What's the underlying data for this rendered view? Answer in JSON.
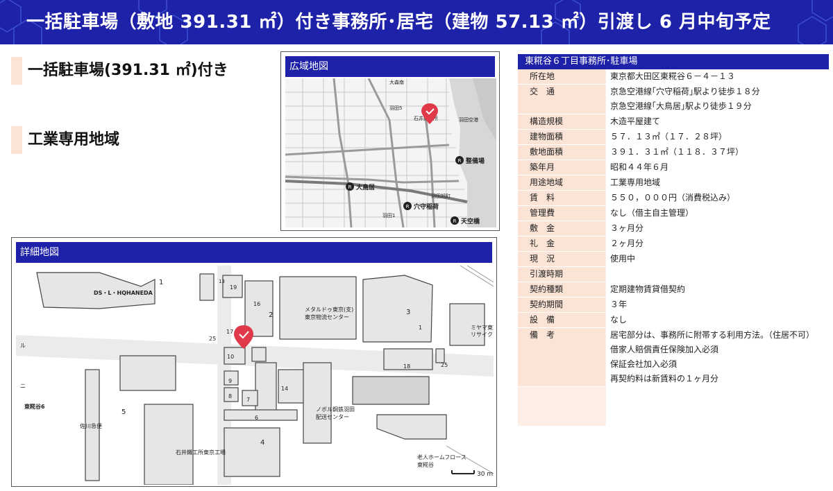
{
  "banner": {
    "title": "一括駐車場（敷地 391.31 ㎡）付き事務所･居宅（建物 57.13 ㎡）引渡し 6 月中旬予定"
  },
  "highlights": [
    {
      "text": "一括駐車場(391.31 ㎡)付き"
    },
    {
      "text": "工業専用地域"
    }
  ],
  "wide_map": {
    "title": "広域地図",
    "labels": {
      "station_otorii": "大鳥居",
      "station_anamori": "穴守稲荷",
      "station_seibijo": "整備場",
      "station_tenku": "天空橋",
      "haneda_airport": "羽田空港",
      "ishii": "石井鐵工所",
      "omori": "大森南",
      "gaso": "羽田旭町",
      "haneda_1": "羽田1",
      "haneda_5": "羽田5"
    }
  },
  "detail_map": {
    "title": "詳細地図",
    "labels": {
      "ds_l": "DS・L・HQHANEDA",
      "metal": "メタルドゥ東京(支)",
      "metal2": "東京物流センター",
      "miyama": "ミヤマ東京",
      "miyama2": "リサイク",
      "higashi": "東糀谷6",
      "sagawa": "佐川急便",
      "nobori": "ノボル鋼鉄羽田",
      "nobori2": "配送センター",
      "ishii_kojo": "石井鐵工所東京工場",
      "roujin": "老人ホームフロース",
      "roujin2": "東糀谷",
      "scale": "30 m",
      "blk_1": "1",
      "blk_2": "2",
      "blk_3": "3",
      "blk_4": "4",
      "blk_5": "5",
      "blk_6": "6",
      "blk_7": "7",
      "blk_8": "8",
      "blk_9": "9",
      "blk_10": "10",
      "blk_13": "13",
      "blk_14": "14",
      "blk_16": "16",
      "blk_17": "17",
      "blk_18": "18",
      "blk_19": "19",
      "blk_25a": "25",
      "blk_25b": "25",
      "blk_1b": "1",
      "edge_ru": "ル",
      "edge_ni": "ニ"
    }
  },
  "spec": {
    "title": "東糀谷６丁目事務所･駐車場",
    "rows": [
      {
        "label": "所在地",
        "values": [
          "東京都大田区東糀谷６－４－１３"
        ]
      },
      {
        "label": "交　通",
        "values": [
          "京急空港線｢穴守稲荷｣駅より徒歩１８分",
          "京急空港線｢大鳥居｣駅より徒歩１９分"
        ]
      },
      {
        "label": "構造規模",
        "values": [
          "木造平屋建て"
        ]
      },
      {
        "label": "建物面積",
        "values": [
          "５７．１３㎡（１７．２８坪）"
        ]
      },
      {
        "label": "敷地面積",
        "values": [
          "３９１．３１㎡（１１８．３７坪）"
        ]
      },
      {
        "label": "築年月",
        "values": [
          "昭和４４年６月"
        ]
      },
      {
        "label": "用途地域",
        "values": [
          "工業専用地域"
        ]
      },
      {
        "label": "賃　料",
        "values": [
          "５５０，０００円（消費税込み）"
        ]
      },
      {
        "label": "管理費",
        "values": [
          "なし（借主自主管理）"
        ]
      },
      {
        "label": "敷　金",
        "values": [
          "３ヶ月分"
        ]
      },
      {
        "label": "礼　金",
        "values": [
          "２ヶ月分"
        ]
      },
      {
        "label": "現　況",
        "values": [
          "使用中"
        ]
      },
      {
        "label": "引渡時期",
        "values": [
          ""
        ]
      },
      {
        "label": "契約種類",
        "values": [
          "定期建物賃貸借契約"
        ]
      },
      {
        "label": "契約期間",
        "values": [
          "３年"
        ]
      },
      {
        "label": "設　備",
        "values": [
          "なし"
        ]
      },
      {
        "label": "備　考",
        "values": [
          "居宅部分は、事務所に附帯する利用方法。（住居不可）",
          "借家人賠償責任保険加入必須",
          "保証会社加入必須",
          "再契約料は新賃料の１ヶ月分"
        ]
      }
    ]
  },
  "colors": {
    "brand_blue": "#1e22a8",
    "highlight_peach": "#fbe3d6",
    "table_bg": "#fdeee5",
    "pin_red": "#e03a4a"
  }
}
